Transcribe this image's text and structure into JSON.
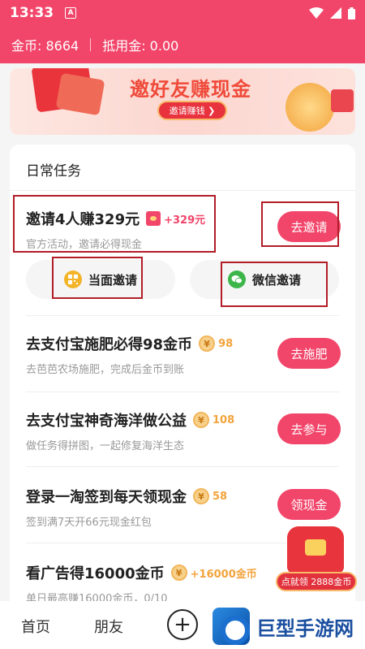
{
  "status_bar": {
    "time": "13:33",
    "badge": "A"
  },
  "top_bar": {
    "coins_label": "金币: 8664",
    "deduct_label": "抵用金: 0.00"
  },
  "banner": {
    "title": "邀好友赚现金",
    "button": "邀请赚钱 ❯",
    "page_count": 3,
    "active_page": 1
  },
  "card": {
    "title": "日常任务",
    "invite_task": {
      "title": "邀请4人赚329元",
      "reward": "+329元",
      "subtitle": "官方活动，邀请必得现金",
      "button": "去邀请",
      "options": [
        {
          "label": "当面邀请",
          "icon": "qrcode-icon"
        },
        {
          "label": "微信邀请",
          "icon": "wechat-icon"
        }
      ]
    },
    "tasks": [
      {
        "title": "去支付宝施肥必得98金币",
        "reward": "98",
        "subtitle": "去芭芭农场施肥，完成后金币到账",
        "button": "去施肥"
      },
      {
        "title": "去支付宝神奇海洋做公益",
        "reward": "108",
        "subtitle": "做任务得拼图，一起修复海洋生态",
        "button": "去参与"
      },
      {
        "title": "登录一淘签到每天领现金",
        "reward": "58",
        "subtitle": "签到满7天开66元现金红包",
        "button": "领现金"
      },
      {
        "title": "看广告得16000金币",
        "reward": "+16000金币",
        "subtitle": "单日最高赚16000金币，0/10",
        "button": ""
      }
    ]
  },
  "float_gift": {
    "label": "点就领 2888金币"
  },
  "bottom_nav": {
    "tabs": [
      "首页",
      "朋友"
    ],
    "plus": "+"
  },
  "watermark": {
    "text": "巨型手游网"
  },
  "colors": {
    "brand": "#f2456a",
    "coin": "#f2a33c",
    "highlight_box": "#b21d28"
  }
}
